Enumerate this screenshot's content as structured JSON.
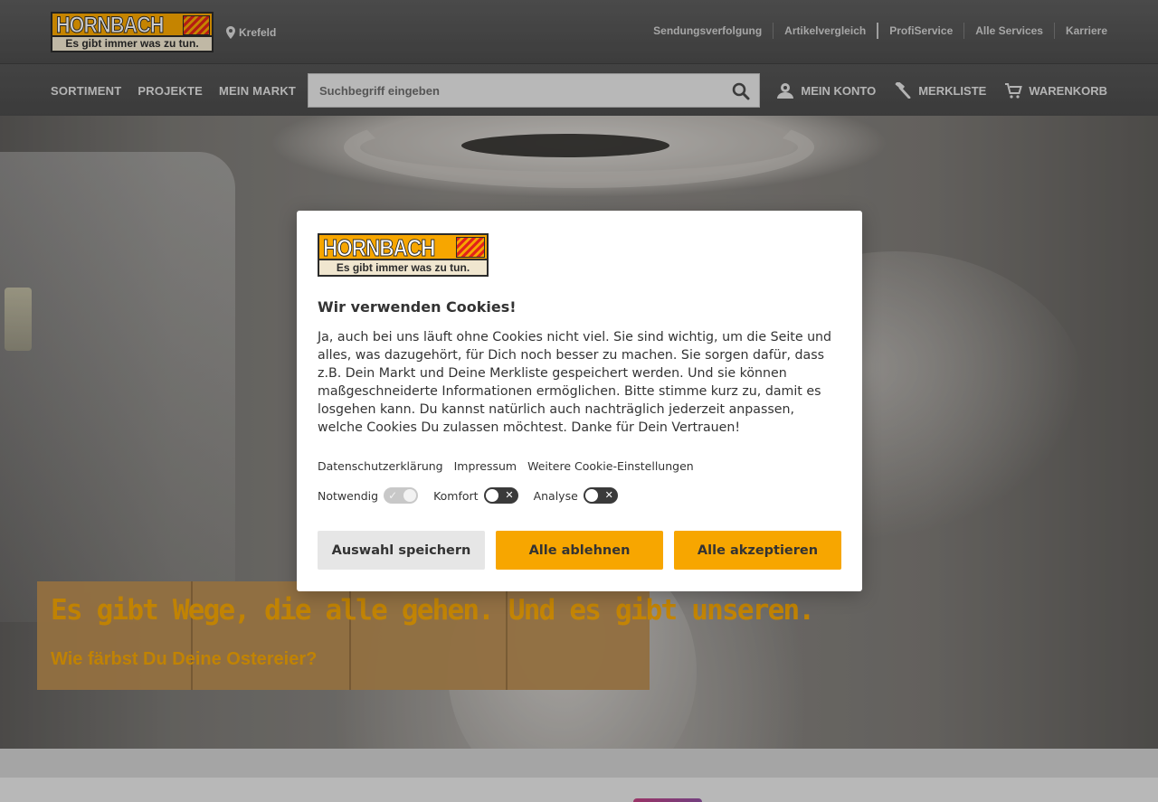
{
  "header": {
    "logo": {
      "brand": "HORNBACH",
      "slogan": "Es gibt immer was zu tun."
    },
    "store": "Krefeld",
    "toplinks": [
      "Sendungsverfolgung",
      "Artikelvergleich",
      "ProfiService",
      "Alle Services",
      "Karriere"
    ]
  },
  "nav": {
    "main": [
      "SORTIMENT",
      "PROJEKTE",
      "MEIN MARKT"
    ],
    "search": {
      "placeholder": "Suchbegriff eingeben"
    },
    "user": {
      "account": "MEIN KONTO",
      "wishlist": "MERKLISTE",
      "cart": "WARENKORB"
    }
  },
  "hero": {
    "headline": "Es gibt Wege, die alle gehen. Und es gibt unseren.",
    "subline": "Wie färbst Du Deine Ostereier?"
  },
  "cookie": {
    "logo": {
      "brand": "HORNBACH",
      "slogan": "Es gibt immer was zu tun."
    },
    "title": "Wir verwenden Cookies!",
    "text": "Ja, auch bei uns läuft ohne Cookies nicht viel. Sie sind wichtig, um die Seite und alles, was dazugehört, für Dich noch besser zu machen. Sie sorgen dafür, dass z.B. Dein Markt und Deine Merkliste gespeichert werden. Und sie können maßgeschneiderte Informationen ermöglichen. Bitte stimme kurz zu, damit es losgehen kann. Du kannst natürlich auch nachträglich jederzeit anpassen, welche Cookies Du zulassen möchtest. Danke für Dein Vertrauen!",
    "links": {
      "privacy": "Datenschutzerklärung",
      "imprint": "Impressum",
      "settings": "Weitere Cookie-Einstellungen"
    },
    "toggles": {
      "necessary": {
        "label": "Notwendig",
        "on": true
      },
      "comfort": {
        "label": "Komfort",
        "on": false
      },
      "analysis": {
        "label": "Analyse",
        "on": false
      }
    },
    "buttons": {
      "save": "Auswahl speichern",
      "reject": "Alle ablehnen",
      "accept": "Alle akzeptieren"
    }
  },
  "colors": {
    "accent": "#f7a600",
    "header": "#4f4f4f",
    "brand_red": "#e2231a"
  }
}
